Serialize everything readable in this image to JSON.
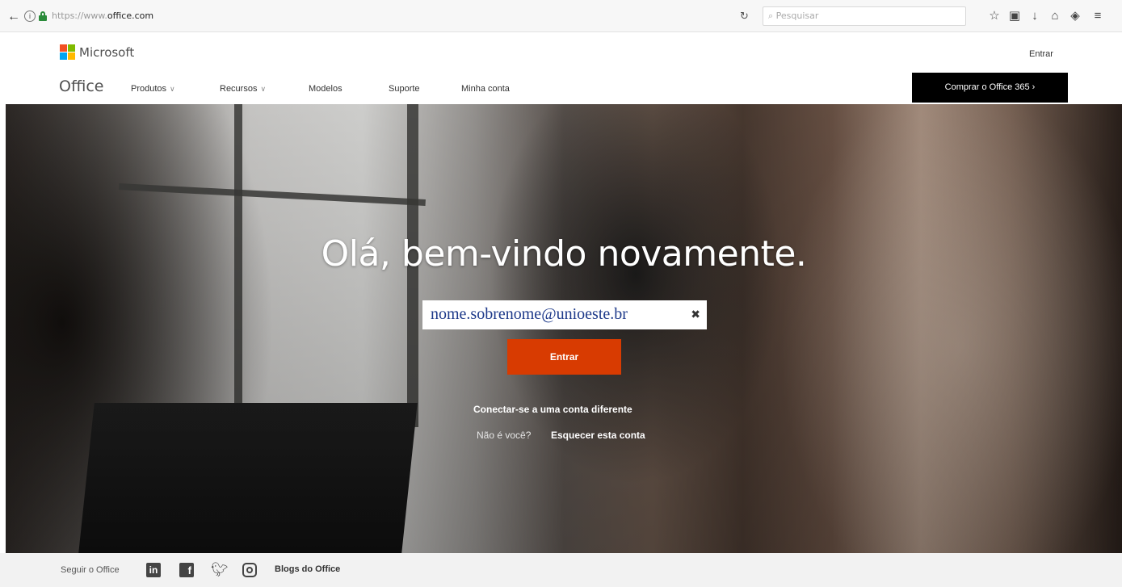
{
  "browser": {
    "url_prefix": "https://www.",
    "url_host": "office.com",
    "search_placeholder": "Pesquisar"
  },
  "header": {
    "brand": "Microsoft",
    "signin": "Entrar",
    "office_title": "Office",
    "nav": [
      {
        "label": "Produtos",
        "has_dropdown": true
      },
      {
        "label": "Recursos",
        "has_dropdown": true
      },
      {
        "label": "Modelos",
        "has_dropdown": false
      },
      {
        "label": "Suporte",
        "has_dropdown": false
      },
      {
        "label": "Minha conta",
        "has_dropdown": false
      }
    ],
    "buy_button": "Comprar o Office 365",
    "logo_colors": [
      "#f25022",
      "#7fba00",
      "#00a4ef",
      "#ffb900"
    ]
  },
  "hero": {
    "headline": "Olá, bem-vindo novamente.",
    "email": "nome.sobrenome@unioeste.br",
    "login_button": "Entrar",
    "switch_account": "Conectar-se a uma conta diferente",
    "not_you": "Não é você?",
    "forget_account": "Esquecer esta conta",
    "button_color": "#d83b01"
  },
  "footer": {
    "follow_label": "Seguir o Office",
    "social": [
      "linkedin-icon",
      "facebook-icon",
      "twitter-icon",
      "instagram-icon"
    ],
    "blogs": "Blogs do Office"
  }
}
